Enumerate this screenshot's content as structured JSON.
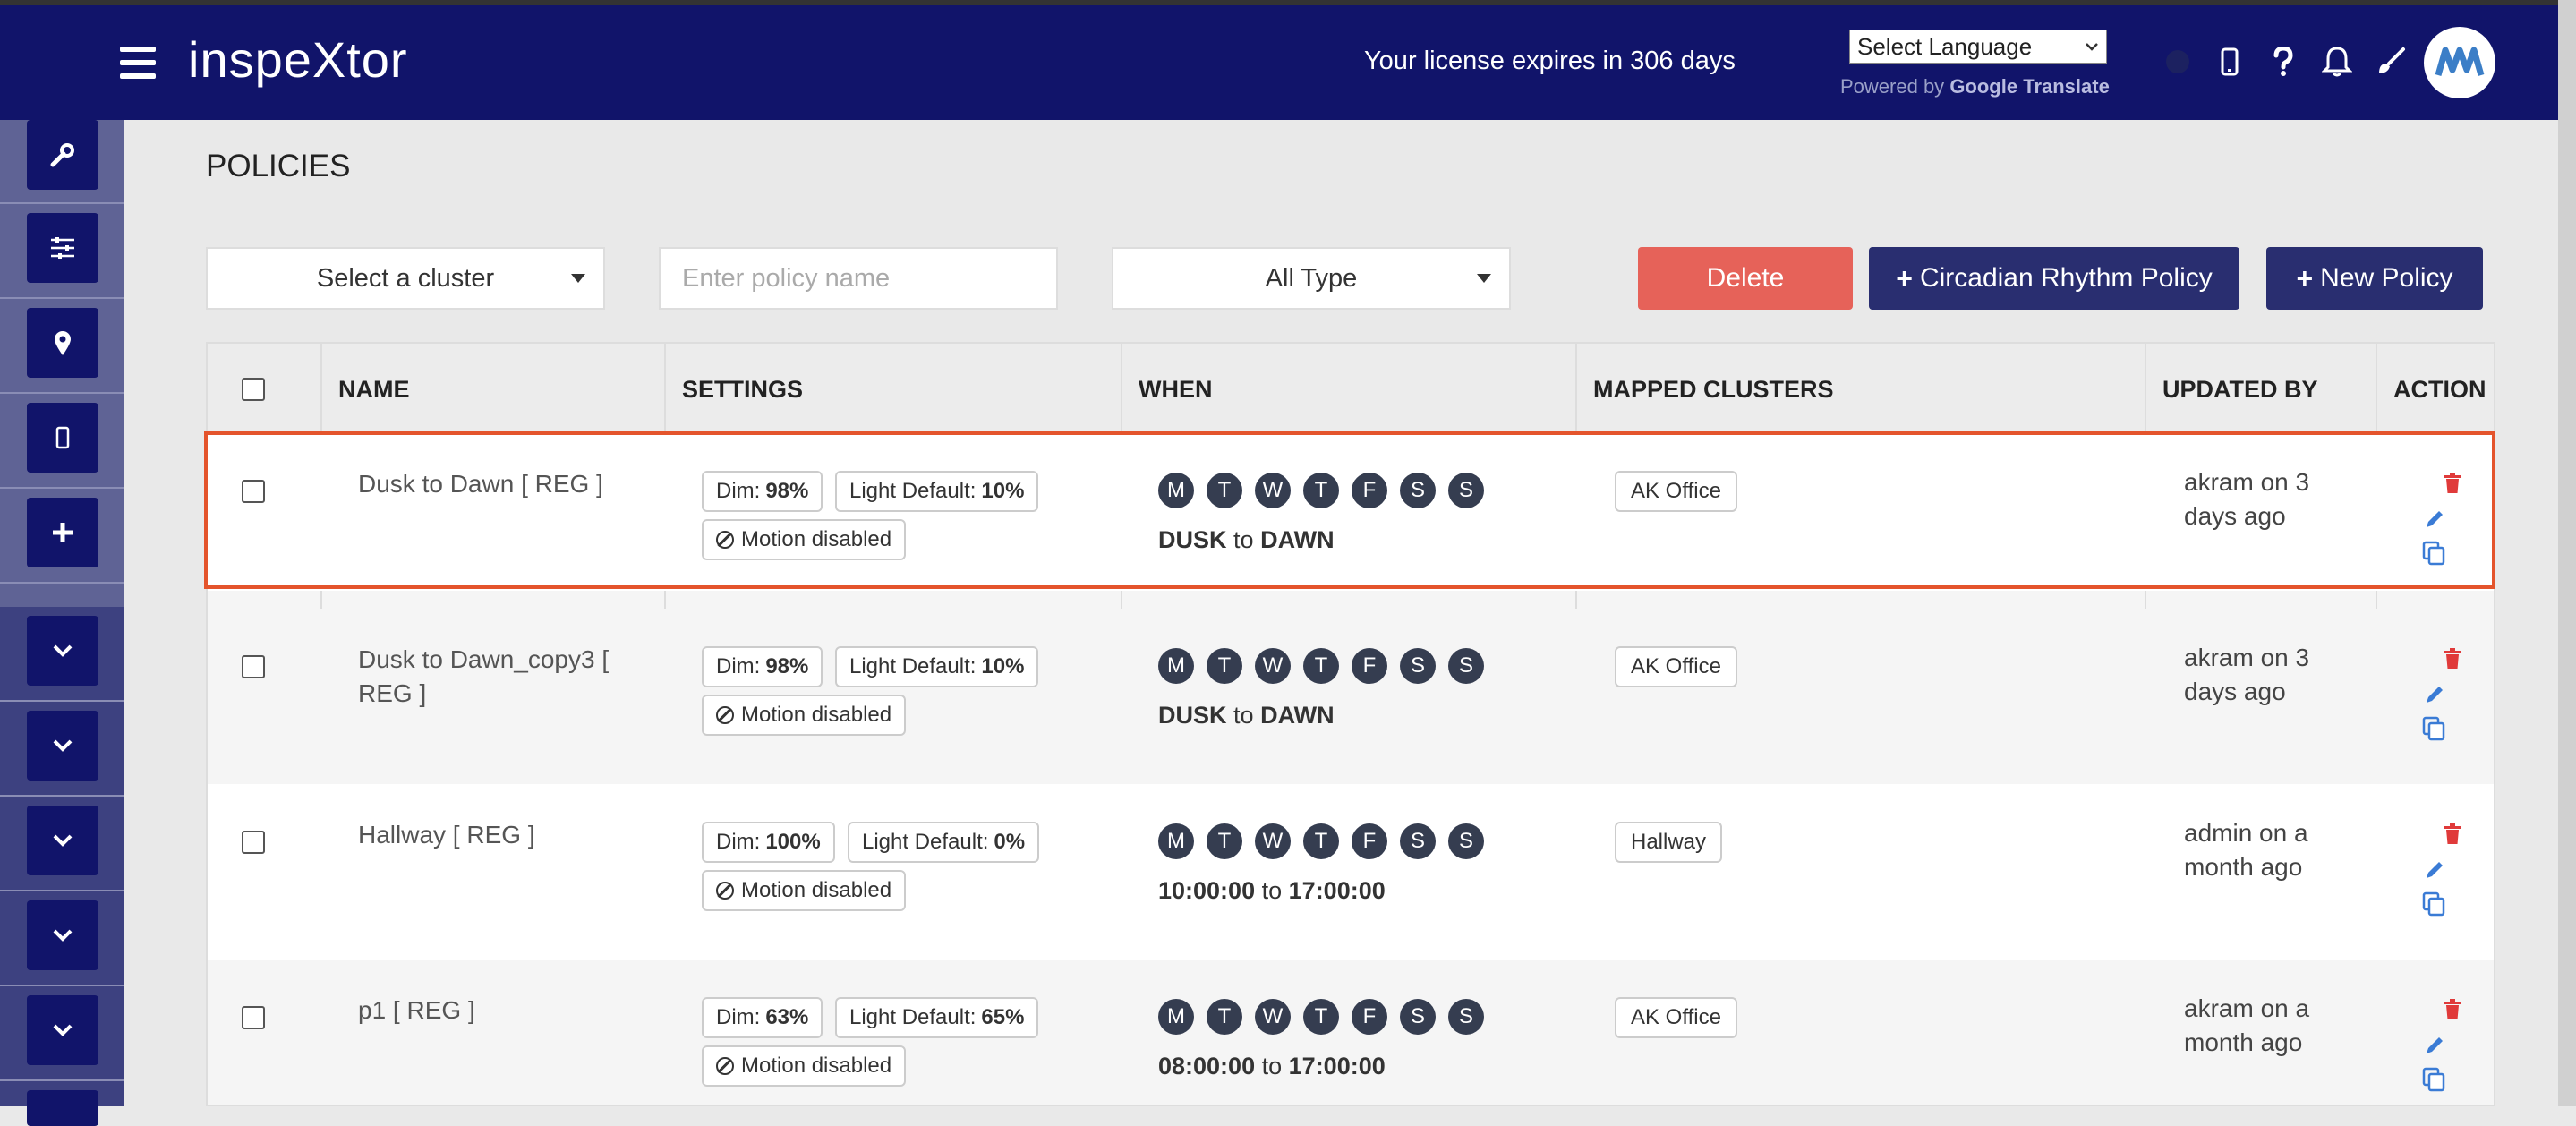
{
  "header": {
    "brand": "inspeXtor",
    "license_text": "Your license expires in 306 days",
    "language_select": "Select Language",
    "powered_by": "Powered by",
    "google": "Google",
    "translate": "Translate",
    "icons": [
      "status-dot",
      "mobile-icon",
      "help-icon",
      "bell-icon",
      "brush-icon"
    ],
    "avatar_logo": "M"
  },
  "sidebar": {
    "items": [
      "wrench-icon",
      "sliders-icon",
      "map-pin-icon",
      "mobile-icon",
      "plus-icon",
      "chevron-down-icon",
      "chevron-down-icon",
      "chevron-down-icon",
      "chevron-down-icon",
      "chevron-down-icon"
    ]
  },
  "page": {
    "title": "POLICIES",
    "cluster_select": "Select a cluster",
    "policy_name_placeholder": "Enter policy name",
    "type_select": "All Type",
    "delete_label": "Delete",
    "circadian_label": "Circadian Rhythm Policy",
    "new_policy_label": "New Policy",
    "plus": "+"
  },
  "table": {
    "columns": {
      "name": "NAME",
      "settings": "SETTINGS",
      "when": "WHEN",
      "mapped": "MAPPED CLUSTERS",
      "updated": "UPDATED BY",
      "action": "ACTION"
    },
    "day_letters": [
      "M",
      "T",
      "W",
      "T",
      "F",
      "S",
      "S"
    ],
    "to_word": "to",
    "rows": [
      {
        "name": "Dusk to Dawn [ REG ]",
        "dim_label": "Dim:",
        "dim": "98%",
        "light_label": "Light Default:",
        "light": "10%",
        "motion": "Motion disabled",
        "from": "DUSK",
        "to": "DAWN",
        "cluster": "AK Office",
        "updated": "akram on 3 days ago",
        "highlighted": true
      },
      {
        "name": "Dusk to Dawn_copy3 [ REG ]",
        "dim_label": "Dim:",
        "dim": "98%",
        "light_label": "Light Default:",
        "light": "10%",
        "motion": "Motion disabled",
        "from": "DUSK",
        "to": "DAWN",
        "cluster": "AK Office",
        "updated": "akram on 3 days ago"
      },
      {
        "name": "Hallway [ REG ]",
        "dim_label": "Dim:",
        "dim": "100%",
        "light_label": "Light Default:",
        "light": "0%",
        "motion": "Motion disabled",
        "from": "10:00:00",
        "to": "17:00:00",
        "cluster": "Hallway",
        "updated": "admin on a month ago"
      },
      {
        "name": "p1 [ REG ]",
        "dim_label": "Dim:",
        "dim": "63%",
        "light_label": "Light Default:",
        "light": "65%",
        "motion": "Motion disabled",
        "from": "08:00:00",
        "to": "17:00:00",
        "cluster": "AK Office",
        "updated": "akram on a month ago"
      }
    ]
  },
  "colors": {
    "header_bg": "#11146a",
    "sidebar_bg": "#5f6395",
    "delete": "#e66259",
    "primary": "#292e70",
    "highlight": "#e4542c",
    "day_chip": "#353d50",
    "trash": "#e03a3a",
    "edit": "#3a7bd5"
  }
}
